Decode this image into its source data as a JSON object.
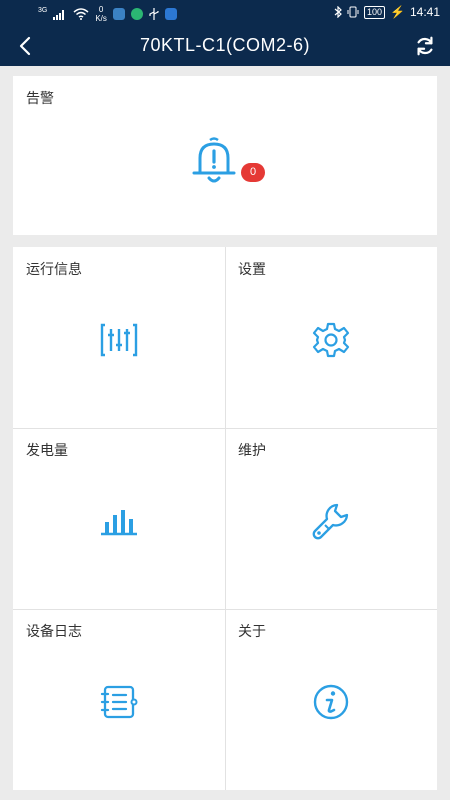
{
  "status_bar": {
    "network": "3G",
    "speed_value": "0",
    "speed_unit": "K/s",
    "battery": "100",
    "time": "14:41"
  },
  "header": {
    "title": "70KTL-C1(COM2-6)"
  },
  "alarm": {
    "label": "告警",
    "count": "0"
  },
  "menu": {
    "items": [
      {
        "label": "运行信息",
        "icon": "sliders-icon"
      },
      {
        "label": "设置",
        "icon": "gear-icon"
      },
      {
        "label": "发电量",
        "icon": "bar-chart-icon"
      },
      {
        "label": "维护",
        "icon": "wrench-icon"
      },
      {
        "label": "设备日志",
        "icon": "log-book-icon"
      },
      {
        "label": "关于",
        "icon": "info-icon"
      }
    ]
  },
  "colors": {
    "header_bg": "#0c2a4d",
    "icon_blue": "#2b9fe3",
    "badge_red": "#e53935"
  }
}
